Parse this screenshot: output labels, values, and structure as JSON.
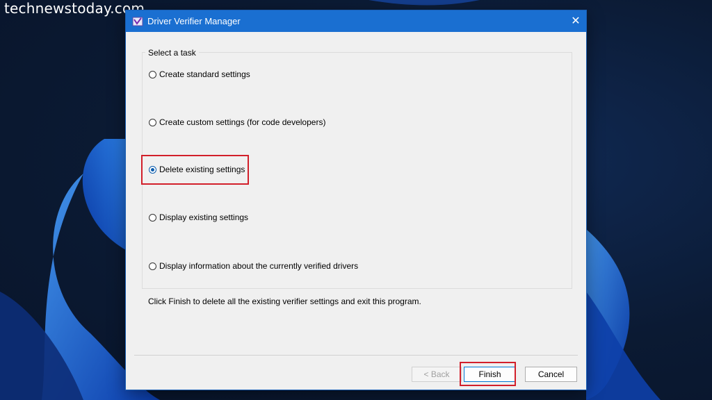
{
  "watermark": "technewstoday.com",
  "window": {
    "title": "Driver Verifier Manager",
    "close_glyph": "✕"
  },
  "group": {
    "label": "Select a task",
    "options": [
      {
        "label": "Create standard settings",
        "checked": false
      },
      {
        "label": "Create custom settings (for code developers)",
        "checked": false
      },
      {
        "label": "Delete existing settings",
        "checked": true
      },
      {
        "label": "Display existing settings",
        "checked": false
      },
      {
        "label": "Display information about the currently verified drivers",
        "checked": false
      }
    ]
  },
  "description": "Click Finish to delete all the existing verifier settings and exit this program.",
  "buttons": {
    "back": "< Back",
    "finish": "Finish",
    "cancel": "Cancel"
  },
  "colors": {
    "titlebar": "#1a6fd1",
    "highlight": "#d21f2a"
  }
}
